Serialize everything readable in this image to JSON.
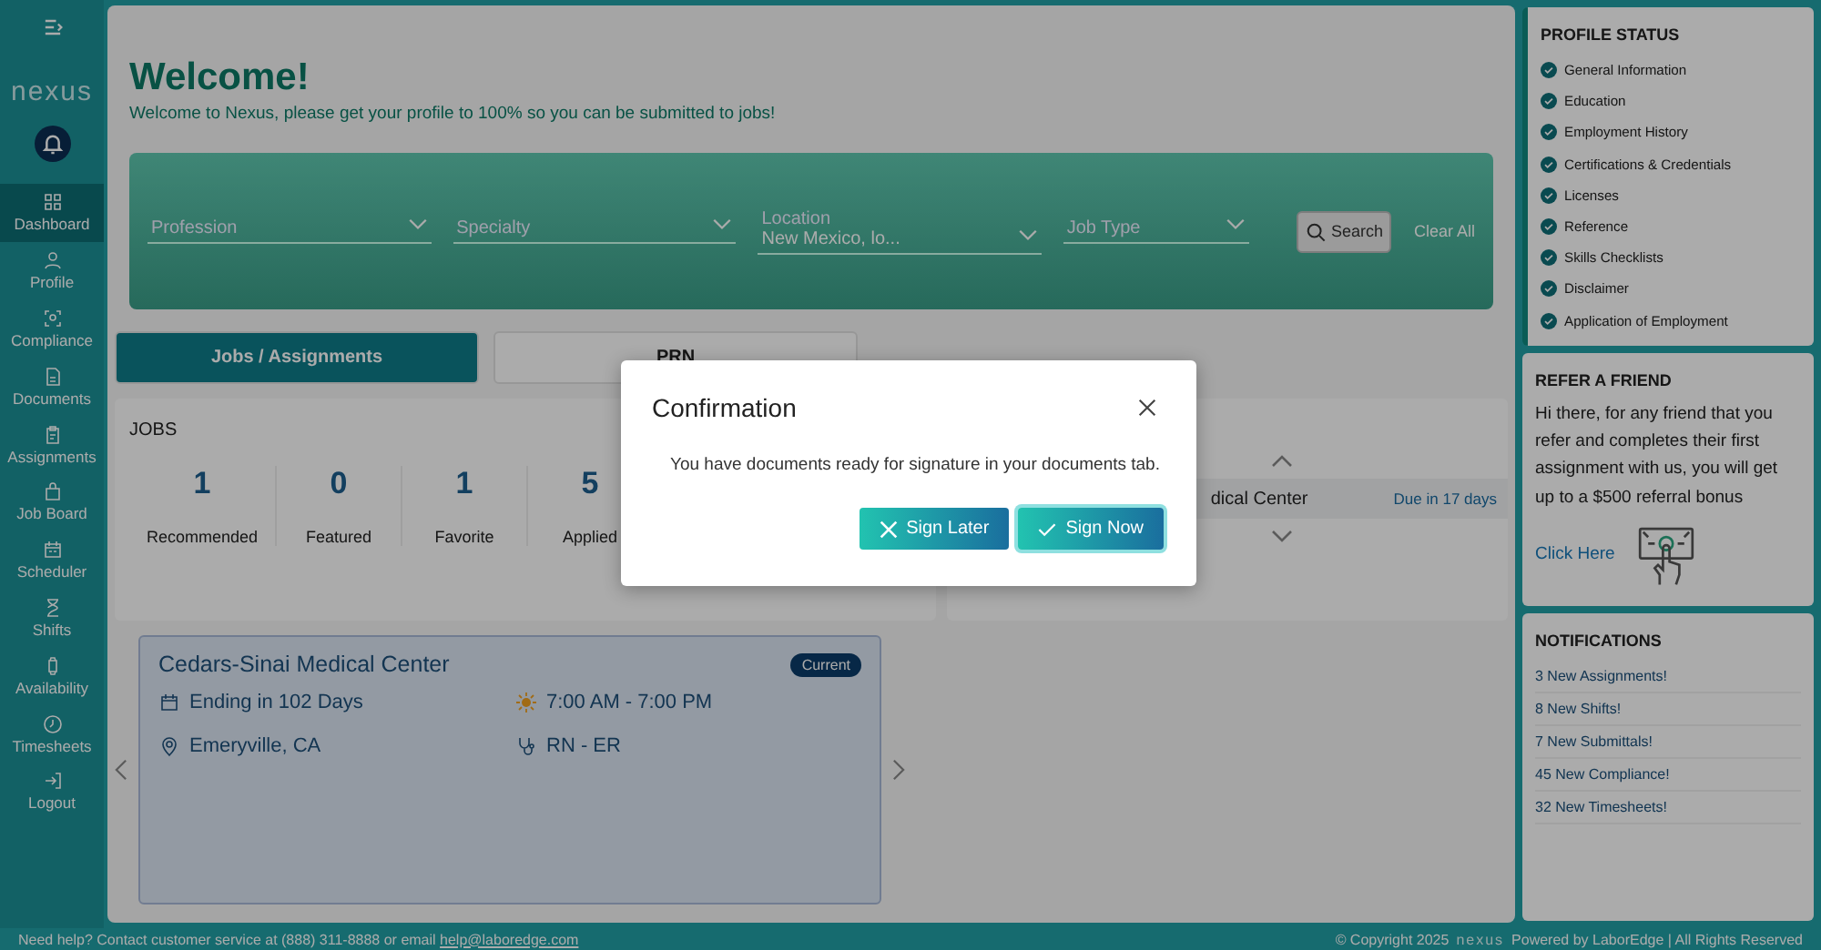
{
  "sidebar": {
    "logo": "nexus",
    "items": [
      {
        "label": "Dashboard",
        "selected": true
      },
      {
        "label": "Profile",
        "selected": false
      },
      {
        "label": "Compliance",
        "selected": false
      },
      {
        "label": "Documents",
        "selected": false
      },
      {
        "label": "Assignments",
        "selected": false
      },
      {
        "label": "Job Board",
        "selected": false
      },
      {
        "label": "Scheduler",
        "selected": false
      },
      {
        "label": "Shifts",
        "selected": false
      },
      {
        "label": "Availability",
        "selected": false
      },
      {
        "label": "Timesheets",
        "selected": false
      },
      {
        "label": "Logout",
        "selected": false
      }
    ]
  },
  "header": {
    "title": "Welcome!",
    "subtitle": "Welcome to Nexus, please get your profile to 100% so you can be submitted to jobs!"
  },
  "search": {
    "fields": [
      {
        "placeholder": "Profession"
      },
      {
        "placeholder": "Specialty"
      },
      {
        "label": "Location",
        "value": "New Mexico, lo..."
      },
      {
        "placeholder": "Job Type"
      }
    ],
    "search_button": "Search",
    "clear_link": "Clear All"
  },
  "tabs": [
    {
      "label": "Jobs / Assignments",
      "selected": true
    },
    {
      "label": "PRN",
      "selected": false
    }
  ],
  "jobs": {
    "title": "JOBS",
    "stats": [
      {
        "value": "1",
        "label": "Recommended"
      },
      {
        "value": "0",
        "label": "Featured"
      },
      {
        "value": "1",
        "label": "Favorite"
      },
      {
        "value": "5",
        "label": "Applied"
      }
    ]
  },
  "upcoming": {
    "facility": "dical Center",
    "due": "Due in 17 days"
  },
  "assignment": {
    "facility": "Cedars-Sinai Medical Center",
    "badge": "Current",
    "ending": "Ending in 102 Days",
    "shift": "7:00 AM - 7:00 PM",
    "location": "Emeryville, CA",
    "role": "RN - ER"
  },
  "profile_status": {
    "title": "PROFILE STATUS",
    "items": [
      {
        "label": "General Information",
        "checked": true
      },
      {
        "label": "Education",
        "checked": true
      },
      {
        "label": "Employment History",
        "checked": true
      },
      {
        "label": "Certifications & Credentials",
        "checked": true
      },
      {
        "label": "Licenses",
        "checked": true
      },
      {
        "label": "Reference",
        "checked": true
      },
      {
        "label": "Skills Checklists",
        "checked": true
      },
      {
        "label": "Disclaimer",
        "checked": true
      },
      {
        "label": "Application of Employment",
        "checked": true
      }
    ]
  },
  "refer": {
    "title": "REFER A FRIEND",
    "text": "Hi there, for any friend that you refer and completes their first assignment with us, you will get up to a $500 referral bonus",
    "link": "Click Here"
  },
  "notifications": {
    "title": "NOTIFICATIONS",
    "items": [
      "3 New Assignments!",
      "8 New Shifts!",
      "7 New Submittals!",
      "45 New Compliance!",
      "32 New Timesheets!"
    ]
  },
  "footer": {
    "help": "Need help? Contact customer service at (888) 311-8888 or email",
    "email": "help@laboredge.com",
    "copyright": "© Copyright 2025",
    "logo": "nexus",
    "powered": "Powered by LaborEdge | All Rights Reserved"
  },
  "modal": {
    "title": "Confirmation",
    "message": "You have documents ready for signature in your documents tab.",
    "buttons": [
      {
        "label": "Sign Later",
        "kind": "cancel"
      },
      {
        "label": "Sign Now",
        "kind": "confirm"
      }
    ]
  }
}
